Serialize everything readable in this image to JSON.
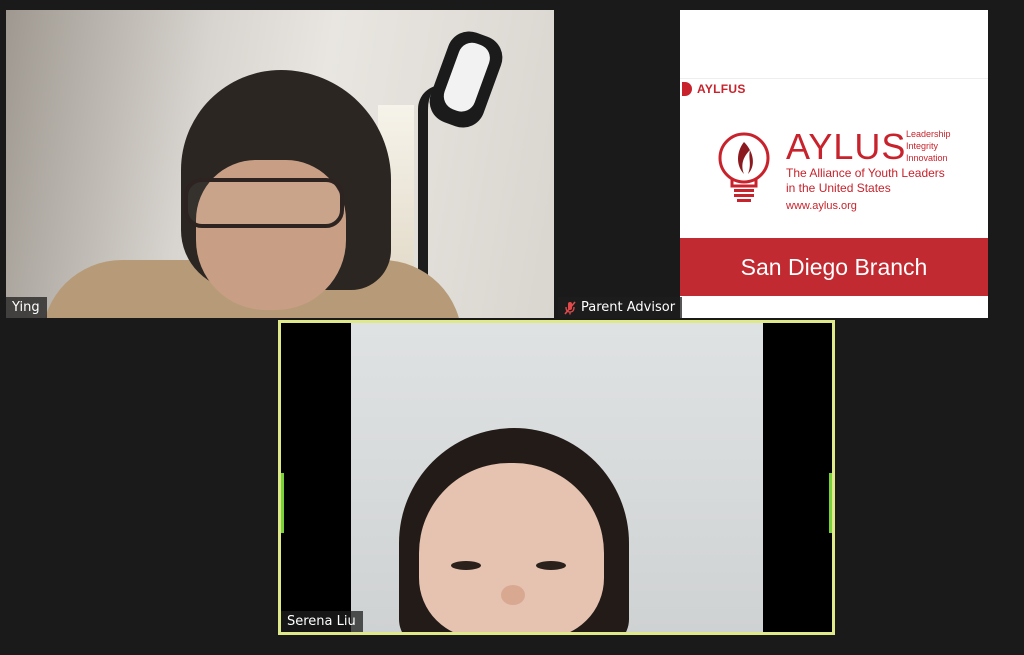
{
  "participants": [
    {
      "name": "Ying",
      "muted": false
    },
    {
      "name": "Parent Advisor",
      "muted": true
    },
    {
      "name": "Serena Liu",
      "muted": false,
      "speaking": true
    }
  ],
  "slide": {
    "small_logo_text": "AYLFUS",
    "title": "AYLUS",
    "motto": [
      "Leadership",
      "Integrity",
      "Innovation"
    ],
    "subtitle_line1": "The Alliance of Youth Leaders",
    "subtitle_line2": "in the United States",
    "url": "www.aylus.org",
    "banner": "San Diego Branch"
  },
  "colors": {
    "brand_red": "#c8232c",
    "speaker_border": "#dfe98a",
    "background": "#1a1a1a"
  }
}
